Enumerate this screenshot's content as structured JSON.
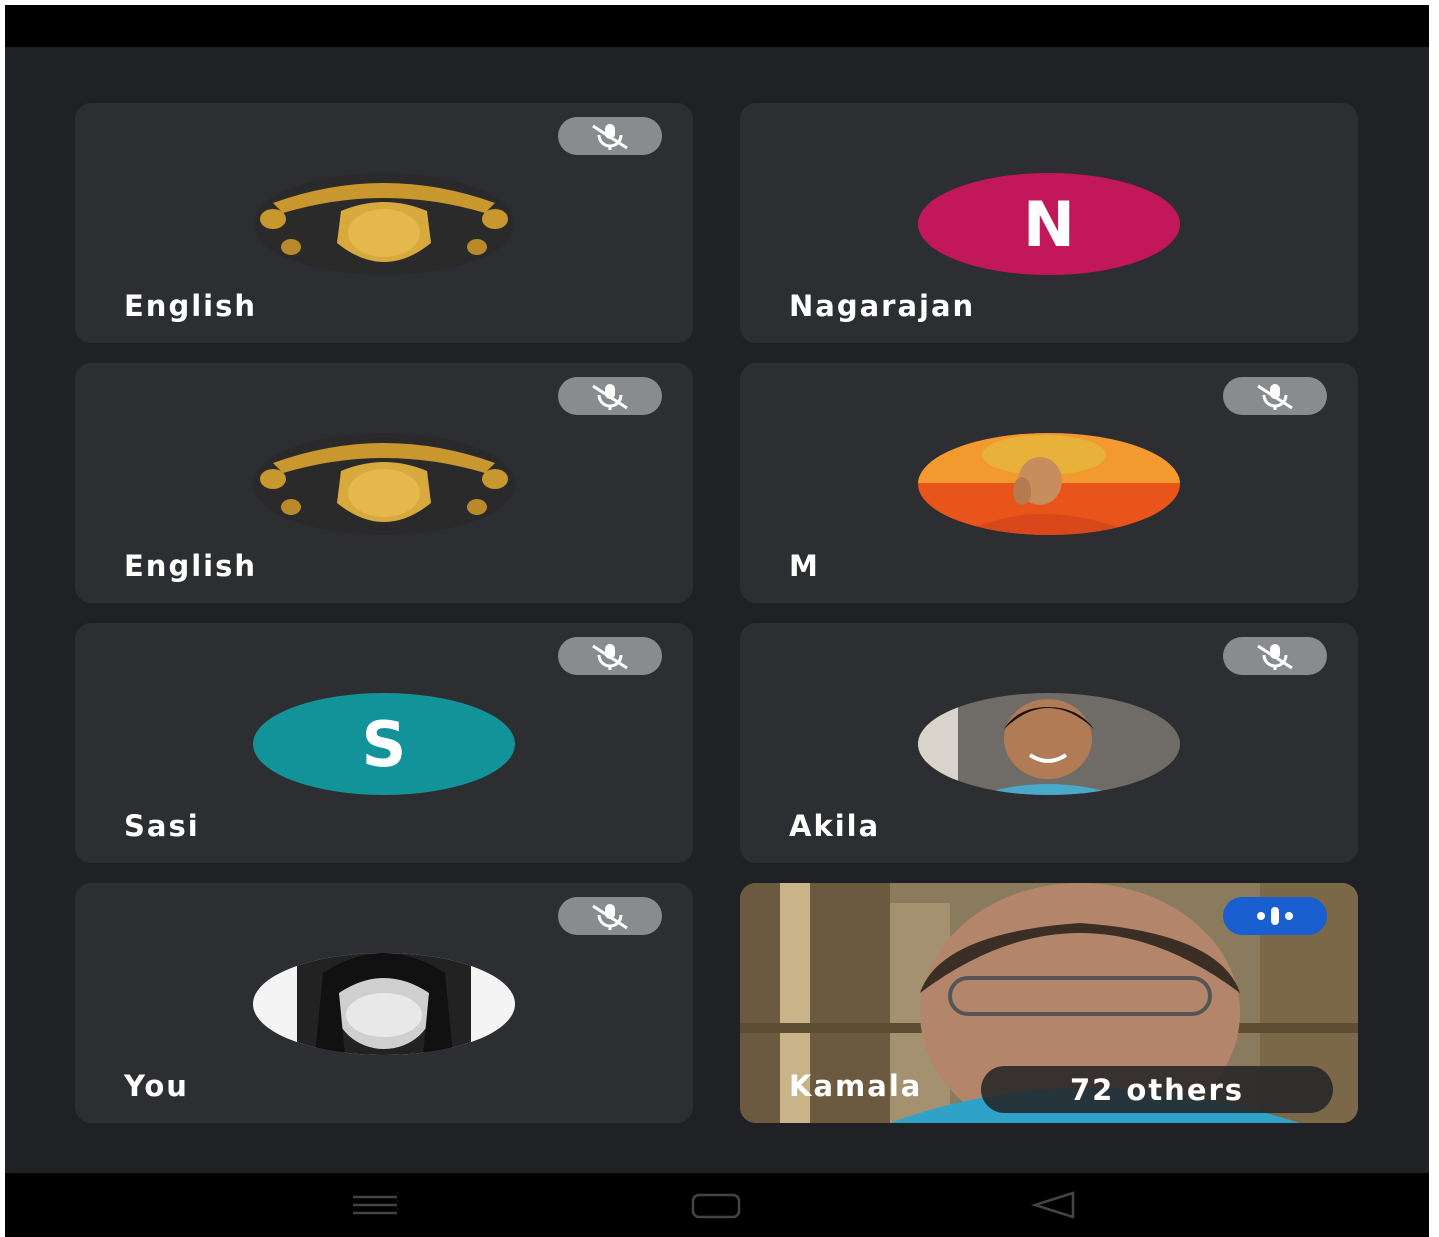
{
  "participants": [
    {
      "name": "English",
      "avatar": "gold-ornament-photo",
      "status": "muted"
    },
    {
      "name": "Nagarajan",
      "avatar_letter": "N",
      "avatar_color": "#c2185b",
      "status": "none"
    },
    {
      "name": "English",
      "avatar": "gold-ornament-photo",
      "status": "muted"
    },
    {
      "name": "M",
      "avatar": "saffron-turban-photo",
      "status": "muted"
    },
    {
      "name": "Sasi",
      "avatar_letter": "S",
      "avatar_color": "#12939a",
      "status": "muted"
    },
    {
      "name": "Akila",
      "avatar": "child-photo",
      "status": "muted"
    },
    {
      "name": "You",
      "avatar": "grayscale-selfie-photo",
      "status": "muted"
    },
    {
      "name": "Kamala",
      "avatar": "live-video",
      "status": "speaking"
    }
  ],
  "others_label": "72 others",
  "colors": {
    "background": "#202124",
    "tile": "#2d2e31",
    "mute_pill": "#8a8b8f",
    "speaking_pill": "#1a5fcf"
  },
  "nav": {
    "recents_icon": "menu-lines-icon",
    "home_icon": "square-icon",
    "back_icon": "triangle-back-icon"
  }
}
